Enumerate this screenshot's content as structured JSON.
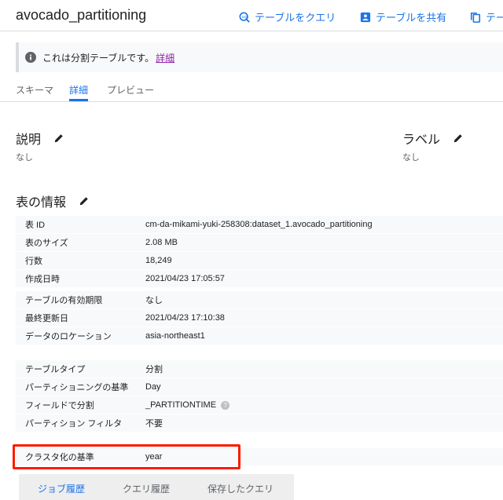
{
  "header": {
    "title": "avocado_partitioning",
    "actions": [
      {
        "label": "テーブルをクエリ",
        "icon": "query-icon"
      },
      {
        "label": "テーブルを共有",
        "icon": "share-icon"
      },
      {
        "label": "テー",
        "icon": "copy-icon"
      }
    ]
  },
  "banner": {
    "text": "これは分割テーブルです。",
    "link": "詳細"
  },
  "tabs": [
    {
      "label": "スキーマ",
      "active": false
    },
    {
      "label": "詳細",
      "active": true
    },
    {
      "label": "プレビュー",
      "active": false
    }
  ],
  "description": {
    "heading": "説明",
    "value": "なし"
  },
  "labels": {
    "heading": "ラベル",
    "value": "なし"
  },
  "table_info": {
    "heading": "表の情報",
    "rows": [
      {
        "key": "表 ID",
        "value": "cm-da-mikami-yuki-258308:dataset_1.avocado_partitioning"
      },
      {
        "key": "表のサイズ",
        "value": "2.08 MB"
      },
      {
        "key": "行数",
        "value": "18,249"
      },
      {
        "key": "作成日時",
        "value": "2021/04/23 17:05:57"
      },
      {
        "key": "テーブルの有効期限",
        "value": "なし"
      },
      {
        "key": "最終更新日",
        "value": "2021/04/23 17:10:38"
      },
      {
        "key": "データのロケーション",
        "value": "asia-northeast1"
      },
      {
        "key": "テーブルタイプ",
        "value": "分割"
      },
      {
        "key": "パーティショニングの基準",
        "value": "Day"
      },
      {
        "key": "フィールドで分割",
        "value": "_PARTITIONTIME"
      },
      {
        "key": "パーティション フィルタ",
        "value": "不要"
      },
      {
        "key": "クラスタ化の基準",
        "value": "year"
      }
    ]
  },
  "bottom_tabs": [
    {
      "label": "ジョブ履歴",
      "active": true
    },
    {
      "label": "クエリ履歴",
      "active": false
    },
    {
      "label": "保存したクエリ",
      "active": false
    }
  ],
  "colors": {
    "accent": "#1a73e8",
    "highlight": "#ff1a00"
  }
}
